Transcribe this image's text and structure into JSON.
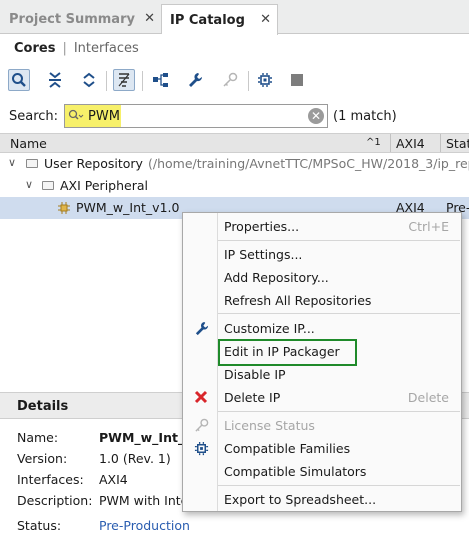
{
  "tabs": [
    {
      "label": "Project Summary",
      "active": false
    },
    {
      "label": "IP Catalog",
      "active": true
    }
  ],
  "subtabs": {
    "cores": "Cores",
    "separator": "|",
    "interfaces": "Interfaces"
  },
  "search": {
    "label": "Search:",
    "value": "PWM",
    "match": "(1 match)"
  },
  "table": {
    "headers": {
      "name": "Name",
      "sort": "^1",
      "axi4": "AXI4",
      "status": "Stat"
    },
    "rows": [
      {
        "chevron": "∨",
        "label": "User Repository",
        "path": "(/home/training/AvnetTTC/MPSoC_HW/2018_3/ip_rep"
      },
      {
        "chevron": "∨",
        "label": "AXI Peripheral"
      },
      {
        "label": "PWM_w_Int_v1.0",
        "axi4": "AXI4",
        "status": "Pre-"
      }
    ]
  },
  "details": {
    "title": "Details",
    "fields": [
      {
        "label": "Name:",
        "value": "PWM_w_Int_"
      },
      {
        "label": "Version:",
        "value": "1.0 (Rev. 1)"
      },
      {
        "label": "Interfaces:",
        "value": "AXI4"
      },
      {
        "label": "Description:",
        "value": "PWM with Inte"
      },
      {
        "label": "Status:",
        "value": "Pre-Production"
      }
    ]
  },
  "context_menu": {
    "items": [
      {
        "label": "Properties...",
        "shortcut": "Ctrl+E"
      },
      {
        "label": "IP Settings..."
      },
      {
        "label": "Add Repository..."
      },
      {
        "label": "Refresh All Repositories"
      },
      {
        "label": "Customize IP..."
      },
      {
        "label": "Edit in IP Packager"
      },
      {
        "label": "Disable IP"
      },
      {
        "label": "Delete IP",
        "shortcut": "Delete"
      },
      {
        "label": "License Status"
      },
      {
        "label": "Compatible Families"
      },
      {
        "label": "Compatible Simulators"
      },
      {
        "label": "Export to Spreadsheet..."
      }
    ]
  },
  "colors": {
    "search_highlight": "#f7f06a",
    "selection": "#cfdcee",
    "highlight_box": "#1f8a2a",
    "delete_icon": "#d9262b",
    "link": "#2a5db0"
  },
  "icons": [
    "search-icon",
    "collapse-all-icon",
    "expand-all-icon",
    "filter-icon",
    "hierarchy-icon",
    "wrench-icon",
    "key-icon",
    "chip-icon",
    "stop-icon",
    "close-icon",
    "folder-icon",
    "ip-core-icon",
    "clear-search-icon"
  ]
}
